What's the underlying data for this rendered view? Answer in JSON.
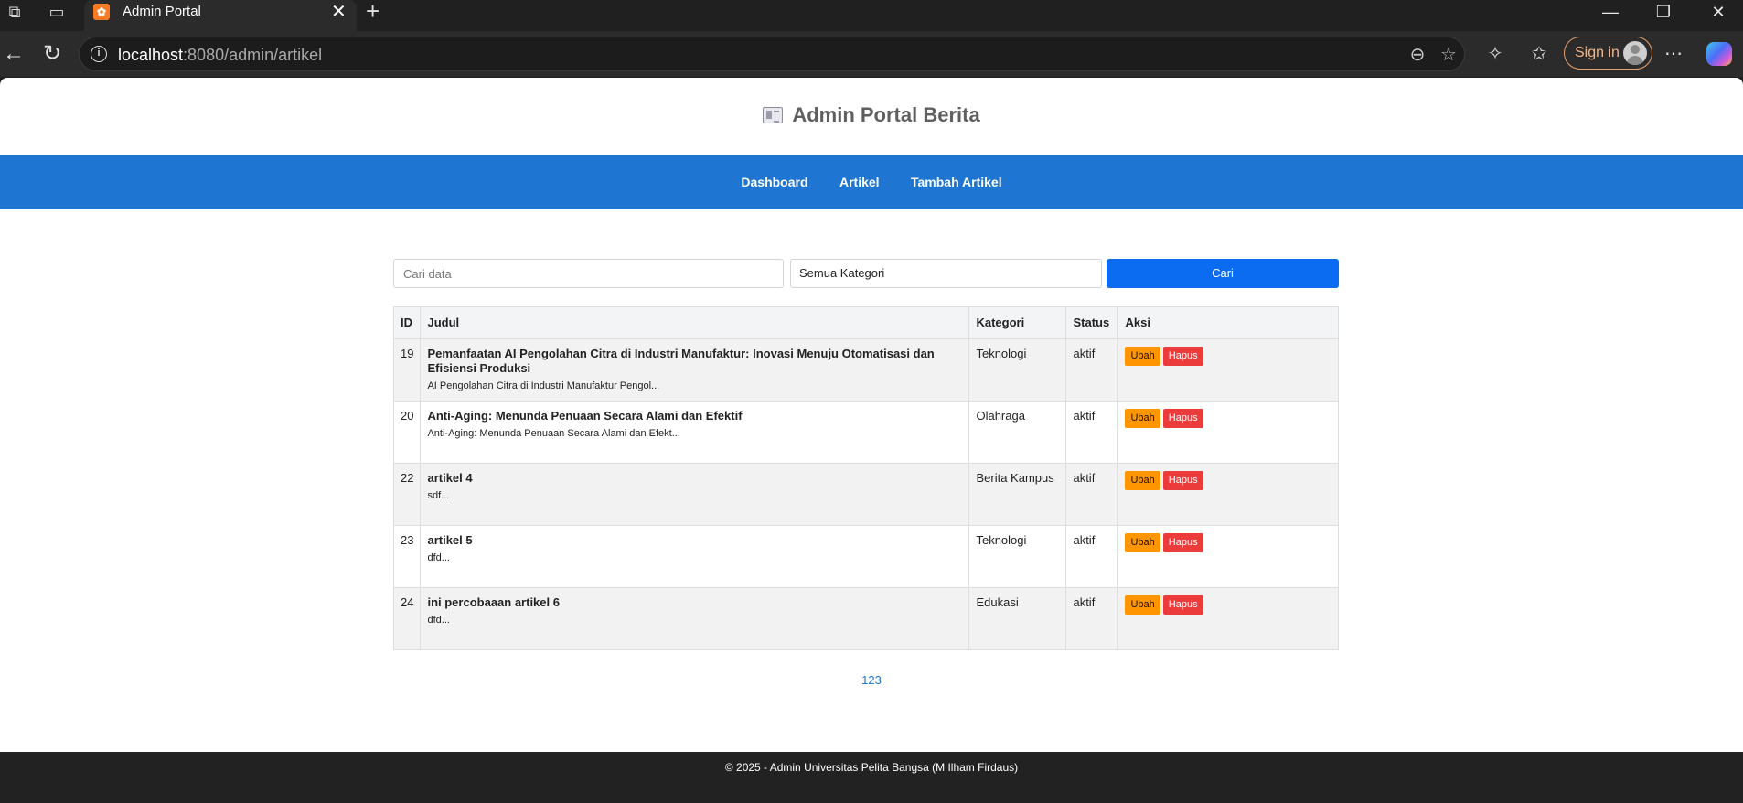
{
  "browser": {
    "tab_title": "Admin Portal",
    "url_host": "localhost",
    "url_rest": ":8080/admin/artikel",
    "sign_in_label": "Sign in"
  },
  "site": {
    "title": "Admin Portal Berita"
  },
  "nav": {
    "items": [
      {
        "label": "Dashboard"
      },
      {
        "label": "Artikel"
      },
      {
        "label": "Tambah Artikel"
      }
    ]
  },
  "search": {
    "placeholder": "Cari data",
    "value": "",
    "category_selected": "Semua Kategori",
    "button_label": "Cari"
  },
  "table": {
    "headers": {
      "id": "ID",
      "judul": "Judul",
      "kategori": "Kategori",
      "status": "Status",
      "aksi": "Aksi"
    },
    "rows": [
      {
        "id": "19",
        "title": "Pemanfaatan AI Pengolahan Citra di Industri Manufaktur: Inovasi Menuju Otomatisasi dan Efisiensi Produksi",
        "excerpt": "AI Pengolahan Citra di Industri Manufaktur Pengol...",
        "category": "Teknologi",
        "status": "aktif",
        "edit": "Ubah",
        "delete": "Hapus"
      },
      {
        "id": "20",
        "title": "Anti-Aging: Menunda Penuaan Secara Alami dan Efektif",
        "excerpt": "Anti-Aging: Menunda Penuaan Secara Alami dan Efekt...",
        "category": "Olahraga",
        "status": "aktif",
        "edit": "Ubah",
        "delete": "Hapus"
      },
      {
        "id": "22",
        "title": "artikel 4",
        "excerpt": "sdf...",
        "category": "Berita Kampus",
        "status": "aktif",
        "edit": "Ubah",
        "delete": "Hapus"
      },
      {
        "id": "23",
        "title": "artikel 5",
        "excerpt": "dfd...",
        "category": "Teknologi",
        "status": "aktif",
        "edit": "Ubah",
        "delete": "Hapus"
      },
      {
        "id": "24",
        "title": "ini percobaaan artikel 6",
        "excerpt": "dfd...",
        "category": "Edukasi",
        "status": "aktif",
        "edit": "Ubah",
        "delete": "Hapus"
      }
    ]
  },
  "pagination": {
    "pages": [
      "1",
      "2",
      "3"
    ]
  },
  "footer": {
    "text": "© 2025 - Admin Universitas Pelita Bangsa (M Ilham Firdaus)"
  },
  "colors": {
    "nav_bg": "#1e75d2",
    "search_button": "#0b6cf2",
    "edit_button": "#ff9500",
    "delete_button": "#ec3b3b",
    "footer_bg": "#222222"
  }
}
